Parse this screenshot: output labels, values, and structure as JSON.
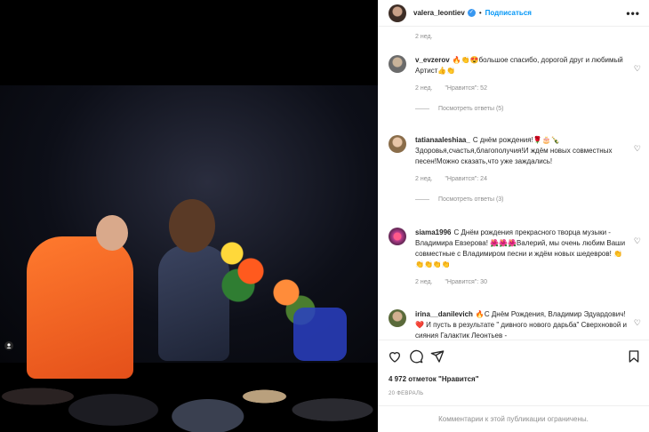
{
  "post": {
    "username": "valera_leontiev",
    "follow_label": "Подписаться",
    "dot": "•",
    "more": "•••"
  },
  "photo": {
    "tag_icon": "user-tag-icon"
  },
  "comments": {
    "first_ago": "2 нед.",
    "items": [
      {
        "user": "v_evzerov",
        "text": "🔥👏😍большое спасибо, дорогой друг и любимый Артист👍👏",
        "ago": "2 нед.",
        "likes": "\"Нравится\": 52",
        "replies": "Посмотреть ответы (5)"
      },
      {
        "user": "tatianaaleshiaa_",
        "text": "С днём рождения!🌹🎂🍾 Здоровья,счастья,благополучия!И ждём новых совместных песен!Можно сказать,что уже заждались!",
        "ago": "2 нед.",
        "likes": "\"Нравится\": 24",
        "replies": "Посмотреть ответы (3)"
      },
      {
        "user": "siama1996",
        "text": "С Днём рождения прекрасного творца музыки - Владимира Евзерова! 🌺🌺🌺Валерий, мы очень любим Ваши совместные с Владимиром песни и ждём новых шедевров! 👏👏👏👏👏",
        "ago": "2 нед.",
        "likes": "\"Нравится\": 30"
      },
      {
        "user": "irina__danilevich",
        "text": "🔥С Днём Рождения, Владимир Эдуардович! ❤️ И пусть в результате \" дивного нового дарьба\" Сверхновой и сияния Галактик Леонтьев -"
      }
    ]
  },
  "footer": {
    "likes_count": "4 972 отметок \"Нравится\"",
    "date": "20 ФЕВРАЛЬ",
    "comments_limited": "Комментарии к этой публикации ограничены."
  },
  "colors": {
    "accent": "#0095f6",
    "muted": "#8e8e8e",
    "verified": "#3897f0"
  }
}
